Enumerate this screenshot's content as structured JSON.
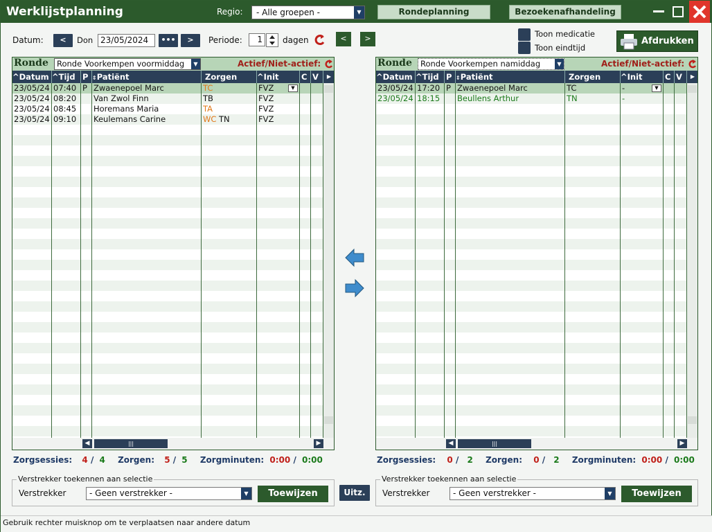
{
  "window": {
    "title": "Werklijstplanning",
    "regio_label": "Regio:",
    "regio_value": "- Alle groepen -",
    "tab_ronde": "Rondeplanning",
    "tab_bezoek": "Bezoekenafhandeling"
  },
  "toolbar": {
    "datum_label": "Datum:",
    "prev": "<",
    "day": "Don",
    "date": "23/05/2024",
    "dots": "•••",
    "next": ">",
    "periode_label": "Periode:",
    "periode_value": "1",
    "dagen_label": "dagen",
    "green_prev": "<",
    "green_next": ">",
    "toon_medicatie": "Toon medicatie",
    "toon_eindtijd": "Toon eindtijd",
    "print": "Afdrukken"
  },
  "columns": {
    "datum": "Datum",
    "tijd": "Tijd",
    "p": "P",
    "patient": "Patiënt",
    "zorgen": "Zorgen",
    "init": "Init",
    "c": "C",
    "v": "V"
  },
  "left": {
    "ronde_label": "Ronde",
    "ronde_value": "Ronde Voorkempen voormiddag",
    "actief_label": "Actief/Niet-actief:",
    "rows": [
      {
        "datum": "23/05/24",
        "tijd": "07:40",
        "p": "P",
        "patient": "Zwaenepoel Marc",
        "z1": "TC",
        "z1c": "org",
        "z2": "",
        "init": "FVZ"
      },
      {
        "datum": "23/05/24",
        "tijd": "08:20",
        "p": "",
        "patient": "Van Zwol Finn",
        "z1": "TB",
        "z1c": "blk",
        "z2": "",
        "init": "FVZ"
      },
      {
        "datum": "23/05/24",
        "tijd": "08:45",
        "p": "",
        "patient": "Horemans Maria",
        "z1": "TA",
        "z1c": "org",
        "z2": "",
        "init": "FVZ"
      },
      {
        "datum": "23/05/24",
        "tijd": "09:10",
        "p": "",
        "patient": "Keulemans Carine",
        "z1": "WC",
        "z1c": "org",
        "z2": "TN",
        "init": "FVZ"
      }
    ],
    "stats": {
      "zs_label": "Zorgsessies:",
      "zs_a": "4",
      "zs_b": "4",
      "z_label": "Zorgen:",
      "z_a": "5",
      "z_b": "5",
      "zm_label": "Zorgminuten:",
      "zm_a": "0:00",
      "zm_b": "0:00"
    },
    "legend": "Verstrekker toekennen aan selectie",
    "verstrekker_label": "Verstrekker",
    "verstrekker_value": "- Geen verstrekker -",
    "toewijzen": "Toewijzen"
  },
  "right": {
    "ronde_label": "Ronde",
    "ronde_value": "Ronde Voorkempen namiddag",
    "actief_label": "Actief/Niet-actief:",
    "rows": [
      {
        "datum": "23/05/24",
        "tijd": "17:20",
        "p": "P",
        "patient": "Zwaenepoel Marc",
        "z1": "TC",
        "z1c": "blk",
        "z2": "",
        "init": "-",
        "green": false
      },
      {
        "datum": "23/05/24",
        "tijd": "18:15",
        "p": "",
        "patient": "Beullens Arthur",
        "z1": "TN",
        "z1c": "blk",
        "z2": "",
        "init": "-",
        "green": true
      }
    ],
    "stats": {
      "zs_label": "Zorgsessies:",
      "zs_a": "0",
      "zs_b": "2",
      "z_label": "Zorgen:",
      "z_a": "0",
      "z_b": "2",
      "zm_label": "Zorgminuten:",
      "zm_a": "0:00",
      "zm_b": "0:00"
    },
    "legend": "Verstrekker toekennen aan selectie",
    "verstrekker_label": "Verstrekker",
    "verstrekker_value": "- Geen verstrekker -",
    "toewijzen": "Toewijzen"
  },
  "uitz": "Uitz.",
  "status": "Gebruik rechter muisknop om te verplaatsen naar andere datum",
  "icons": {
    "minimize": "minimize-icon",
    "maximize": "maximize-icon",
    "close": "close-icon",
    "printer": "printer-icon",
    "refresh": "refresh-icon",
    "arrow_left": "arrow-left-icon",
    "arrow_right": "arrow-right-icon"
  },
  "colors": {
    "primary_green": "#2c5a2c",
    "nav_blue": "#2b3f58",
    "header_green": "#b7d5b7",
    "stripe": "#edf3ed",
    "selected_row": "#b8d5b8",
    "alert_red": "#c0201a",
    "orange": "#e07818"
  }
}
